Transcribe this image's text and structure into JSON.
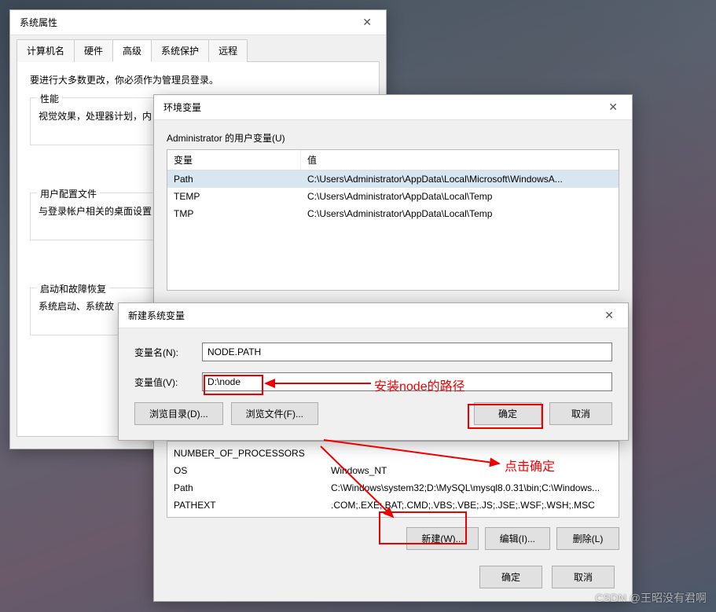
{
  "sysprop": {
    "title": "系统属性",
    "tabs": [
      "计算机名",
      "硬件",
      "高级",
      "系统保护",
      "远程"
    ],
    "active_tab": 2,
    "notice": "要进行大多数更改，你必须作为管理员登录。",
    "grp_perf": "性能",
    "grp_perf_text": "视觉效果，处理器计划，内",
    "grp_user": "用户配置文件",
    "grp_user_text": "与登录帐户相关的桌面设置",
    "grp_boot": "启动和故障恢复",
    "grp_boot_text": "系统启动、系统故"
  },
  "env": {
    "title": "环境变量",
    "user_section": "Administrator 的用户变量(U)",
    "col_var": "变量",
    "col_val": "值",
    "user_rows": [
      {
        "var": "Path",
        "val": "C:\\Users\\Administrator\\AppData\\Local\\Microsoft\\WindowsA..."
      },
      {
        "var": "TEMP",
        "val": "C:\\Users\\Administrator\\AppData\\Local\\Temp"
      },
      {
        "var": "TMP",
        "val": "C:\\Users\\Administrator\\AppData\\Local\\Temp"
      }
    ],
    "sys_rows": [
      {
        "var": "NUMBER_OF_PROCESSORS",
        "val": ""
      },
      {
        "var": "OS",
        "val": "Windows_NT"
      },
      {
        "var": "Path",
        "val": "C:\\Windows\\system32;D:\\MySQL\\mysql8.0.31\\bin;C:\\Windows..."
      },
      {
        "var": "PATHEXT",
        "val": ".COM;.EXE;.BAT;.CMD;.VBS;.VBE;.JS;.JSE;.WSF;.WSH;.MSC"
      }
    ],
    "btn_new": "新建(W)...",
    "btn_edit": "编辑(I)...",
    "btn_del": "删除(L)",
    "btn_ok": "确定",
    "btn_cancel": "取消"
  },
  "newvar": {
    "title": "新建系统变量",
    "lbl_name": "变量名(N):",
    "lbl_value": "变量值(V):",
    "val_name": "NODE.PATH",
    "val_value": "D:\\node",
    "btn_browse_dir": "浏览目录(D)...",
    "btn_browse_file": "浏览文件(F)...",
    "btn_ok": "确定",
    "btn_cancel": "取消"
  },
  "ann": {
    "path_hint": "安装node的路径",
    "click_ok": "点击确定"
  },
  "watermark": "CSDN @王昭没有君啊"
}
